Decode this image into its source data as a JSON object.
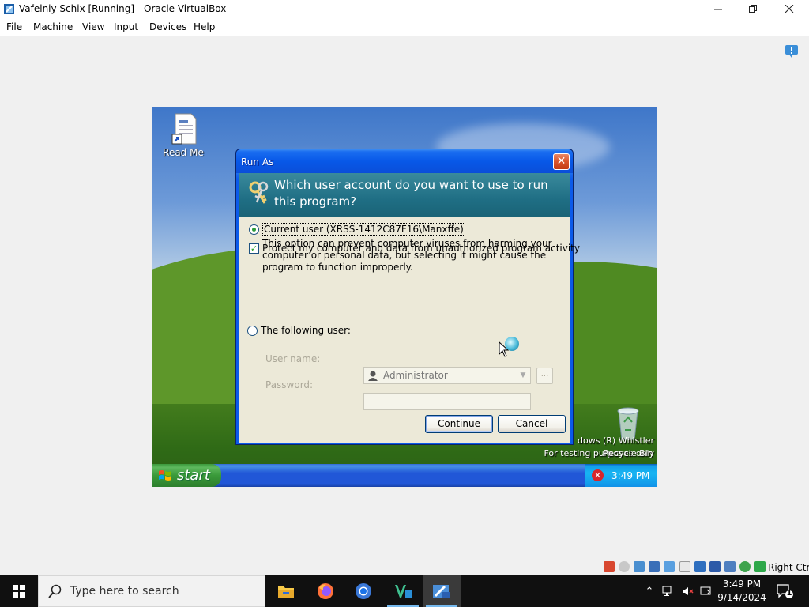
{
  "vbox": {
    "title": "Vafelniy  Schix [Running] - Oracle VirtualBox",
    "menu": [
      "File",
      "Machine",
      "View",
      "Input",
      "Devices",
      "Help"
    ],
    "host_key": "Right Ctrl"
  },
  "guest": {
    "desktop_icons": [
      {
        "label": "Read Me",
        "icon": "document-shortcut-icon"
      },
      {
        "label": "Recycle Bin",
        "icon": "recycle-bin-icon"
      }
    ],
    "watermark": [
      "dows (R) Whistler",
      "For testing purposes only"
    ],
    "taskbar": {
      "start_label": "start",
      "clock": "3:49 PM"
    }
  },
  "dialog": {
    "title": "Run As",
    "question": "Which user account do you want to use to run this program?",
    "current_user_label": "Current user (XRSS-1412C87F16\\Manxffe)",
    "current_user_selected": true,
    "protect_label": "Protect my computer and data from unauthorized program activity",
    "protect_checked": true,
    "description": "This option can prevent computer viruses from harming your computer or personal data, but selecting it might cause the program to function improperly.",
    "following_user_label": "The following user:",
    "username_label": "User name:",
    "username_value": "Administrator",
    "browse_label": "...",
    "password_label": "Password:",
    "continue_label": "Continue",
    "cancel_label": "Cancel"
  },
  "host_taskbar": {
    "search_placeholder": "Type here to search",
    "apps": [
      "file-explorer-icon",
      "firefox-icon",
      "chrome-icon",
      "visual-studio-code-icon",
      "virtualbox-icon"
    ],
    "time": "3:49 PM",
    "date": "9/14/2024",
    "notification_count": "1"
  },
  "colors": {
    "dialog_header": "#1f6e84",
    "xp_blue": "#2157d7",
    "xp_start_green": "#3a9a3a"
  }
}
